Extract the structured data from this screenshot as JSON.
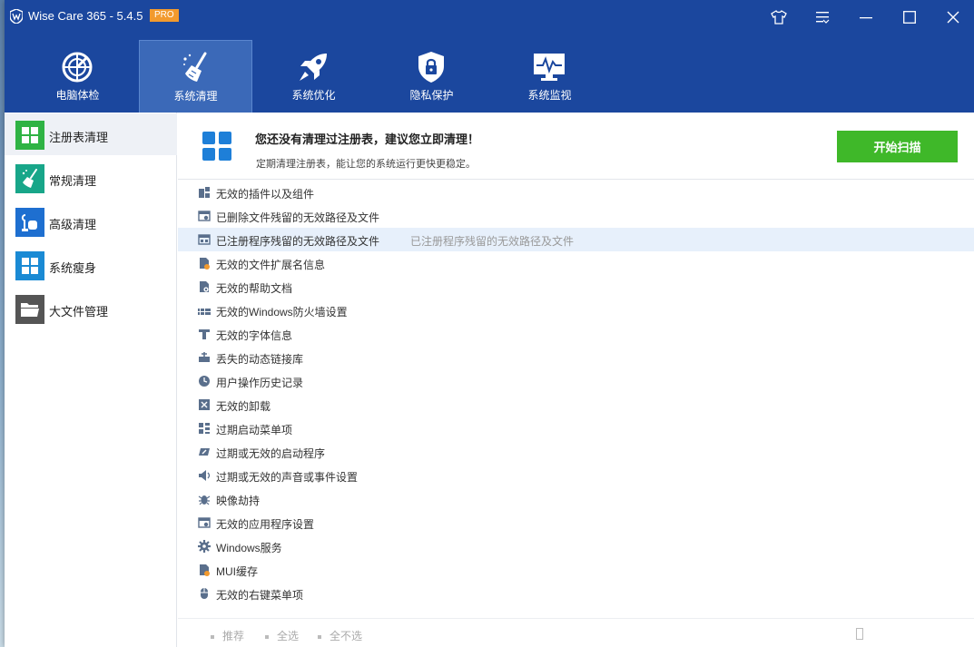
{
  "window": {
    "title": "Wise Care 365 - 5.4.5",
    "badge": "PRO"
  },
  "tabs": [
    {
      "label": "电脑体检",
      "icon": "radar-icon"
    },
    {
      "label": "系统清理",
      "icon": "broom-icon"
    },
    {
      "label": "系统优化",
      "icon": "rocket-icon"
    },
    {
      "label": "隐私保护",
      "icon": "shield-lock-icon"
    },
    {
      "label": "系统监视",
      "icon": "monitor-pulse-icon"
    }
  ],
  "sidebar": {
    "items": [
      {
        "label": "注册表清理",
        "color": "#2fb344"
      },
      {
        "label": "常规清理",
        "color": "#18a689"
      },
      {
        "label": "高级清理",
        "color": "#1e6fd0"
      },
      {
        "label": "系统瘦身",
        "color": "#1a8ad4"
      },
      {
        "label": "大文件管理",
        "color": "#555555"
      }
    ]
  },
  "header": {
    "title": "您还没有清理过注册表，建议您立即清理！",
    "subtitle": "定期清理注册表，能让您的系统运行更快更稳定。",
    "scan_label": "开始扫描"
  },
  "items": [
    {
      "label": "无效的插件以及组件",
      "icon": "plugin-icon"
    },
    {
      "label": "已删除文件残留的无效路径及文件",
      "icon": "deleted-file-icon"
    },
    {
      "label": "已注册程序残留的无效路径及文件",
      "icon": "program-window-icon",
      "desc": "已注册程序残留的无效路径及文件"
    },
    {
      "label": "无效的文件扩展名信息",
      "icon": "file-extension-icon"
    },
    {
      "label": "无效的帮助文档",
      "icon": "help-doc-icon"
    },
    {
      "label": "无效的Windows防火墙设置",
      "icon": "firewall-icon"
    },
    {
      "label": "无效的字体信息",
      "icon": "font-icon"
    },
    {
      "label": "丢失的动态链接库",
      "icon": "dll-icon"
    },
    {
      "label": "用户操作历史记录",
      "icon": "history-icon"
    },
    {
      "label": "无效的卸载",
      "icon": "uninstall-icon"
    },
    {
      "label": "过期启动菜单项",
      "icon": "start-menu-icon"
    },
    {
      "label": "过期或无效的启动程序",
      "icon": "startup-icon"
    },
    {
      "label": "过期或无效的声音或事件设置",
      "icon": "sound-icon"
    },
    {
      "label": "映像劫持",
      "icon": "bug-icon"
    },
    {
      "label": "无效的应用程序设置",
      "icon": "app-settings-icon"
    },
    {
      "label": "Windows服务",
      "icon": "gear-icon"
    },
    {
      "label": "MUI缓存",
      "icon": "mui-cache-icon"
    },
    {
      "label": "无效的右键菜单项",
      "icon": "mouse-icon"
    }
  ],
  "footer": {
    "recommend": "推荐",
    "select_all": "全选",
    "select_none": "全不选"
  },
  "colors": {
    "titlebar": "#1b479e",
    "tab_active": "#3b69b8",
    "scan_button": "#3fb829",
    "highlight_row": "#e7f0fb"
  }
}
